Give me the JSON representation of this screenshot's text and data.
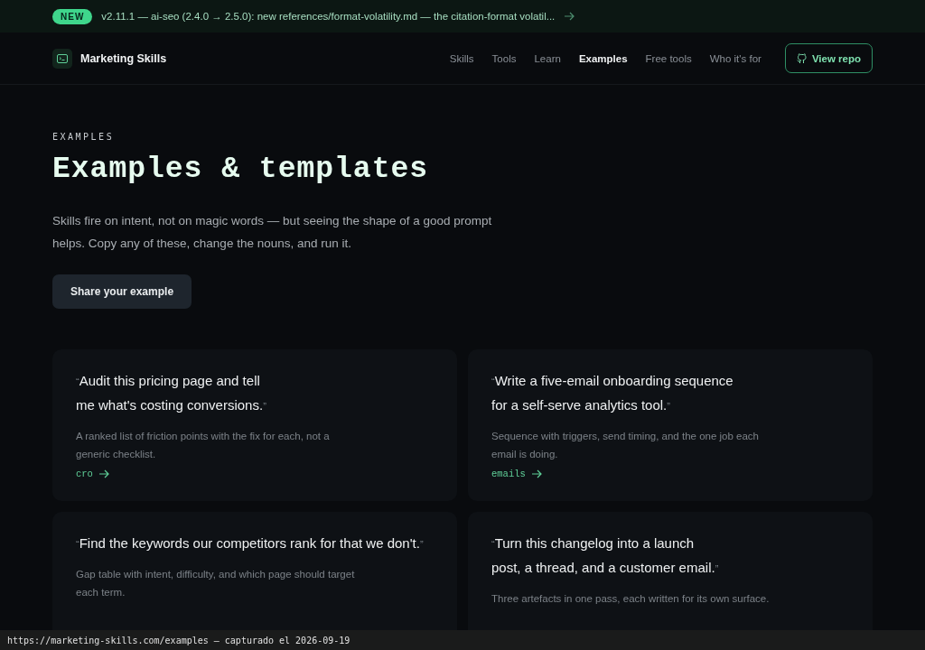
{
  "announcement": {
    "badge": "NEW",
    "text": "v2.11.1 — ai-seo (2.4.0 → 2.5.0): new references/format-volatility.md — the citation-format volatil..."
  },
  "brand": {
    "name": "Marketing Skills"
  },
  "nav": [
    {
      "label": "Skills",
      "selected": false
    },
    {
      "label": "Tools",
      "selected": false
    },
    {
      "label": "Learn",
      "selected": false
    },
    {
      "label": "Examples",
      "selected": true
    },
    {
      "label": "Free tools",
      "selected": false
    },
    {
      "label": "Who it's for",
      "selected": false
    }
  ],
  "repo_button": "View repo",
  "hero": {
    "eyebrow": "EXAMPLES",
    "title": "Examples & templates",
    "lead": "Skills fire on intent, not on magic words — but seeing the shape of a good prompt helps. Copy any of these, change the nouns, and run it.",
    "button": "Share your example"
  },
  "cards": [
    {
      "prompt_lines": [
        "“Audit this pricing page and tell",
        "me what's costing conversions.”"
      ],
      "description": "A ranked list of friction points with the fix for each, not a generic checklist.",
      "tag": "cro"
    },
    {
      "prompt_lines": [
        "“Write a five-email onboarding sequence",
        "for a self-serve analytics tool.”"
      ],
      "description": "Sequence with triggers, send timing, and the one job each email is doing.",
      "tag": "emails"
    },
    {
      "prompt_lines": [
        "“Find the keywords our competitors rank for that we don't.”"
      ],
      "description": "Gap table with intent, difficulty, and which page should target each term."
    },
    {
      "prompt_lines": [
        "“Turn this changelog into a launch",
        "post, a thread, and a customer email.”"
      ],
      "description": "Three artefacts in one pass, each written for its own surface."
    }
  ],
  "caption": "https://marketing-skills.com/examples — capturado el 2026-09-19"
}
